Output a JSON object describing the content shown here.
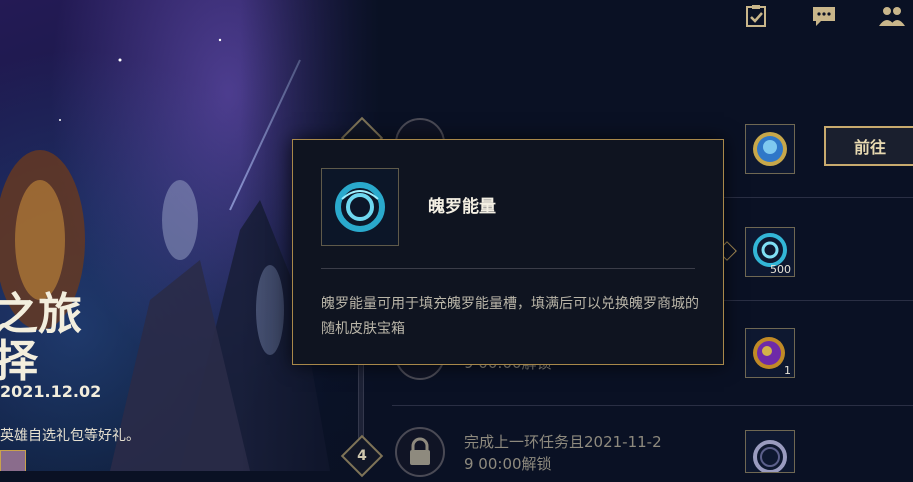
{
  "event_art": {
    "title_line1": "之旅",
    "title_line2": "择",
    "date": "2021.12.02",
    "description": "英雄自选礼包等好礼。"
  },
  "top_icons": [
    "task-list-icon",
    "chat-icon",
    "friends-icon"
  ],
  "tasks": [
    {
      "step": "",
      "text_line1": "",
      "text_line2": "",
      "reward_qty": "",
      "reward_icon": "crystal-gem-icon"
    },
    {
      "step": "",
      "text_line1": "",
      "text_line2": "",
      "reward_qty": "500",
      "reward_icon": "soul-energy-icon"
    },
    {
      "step": "",
      "text_line1": "",
      "text_line2": "9 00:00解锁",
      "reward_qty": "1",
      "reward_icon": "purple-orb-icon"
    },
    {
      "step": "4",
      "text_line1": "完成上一环任务且2021-11-2",
      "text_line2": "9 00:00解锁",
      "reward_qty": "",
      "reward_icon": "silver-ring-icon"
    }
  ],
  "go_button_label": "前往",
  "tooltip": {
    "title": "魄罗能量",
    "description": "魄罗能量可用于填充魄罗能量槽，填满后可以兑换魄罗商城的随机皮肤宝箱",
    "icon": "soul-energy-icon"
  },
  "colors": {
    "gold": "#c8aa6e",
    "background": "#0a1124"
  }
}
